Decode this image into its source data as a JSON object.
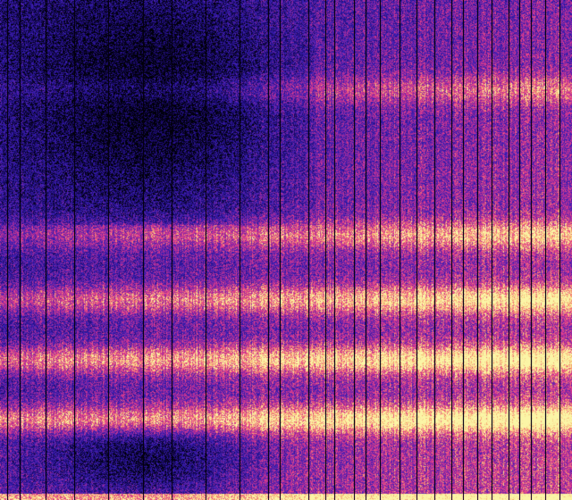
{
  "chart_data": {
    "type": "heatmap",
    "title": "",
    "xlabel": "",
    "ylabel": "",
    "colormap": "plasma-like",
    "colors": {
      "min": "#000008",
      "low": "#1a0a6e",
      "mid_low": "#3a1fb6",
      "mid": "#a02a9c",
      "mid_high": "#e83f8a",
      "high": "#f7aa6e",
      "max": "#fbf5a6"
    },
    "value_range": [
      0,
      1
    ],
    "grid": false,
    "legend": "none",
    "horizontal_bands": [
      {
        "row_fraction": 0.18,
        "intensity_left": 0.15,
        "intensity_right": 0.55
      },
      {
        "row_fraction": 0.47,
        "intensity_left": 0.35,
        "intensity_right": 0.78
      },
      {
        "row_fraction": 0.6,
        "intensity_left": 0.55,
        "intensity_right": 0.92
      },
      {
        "row_fraction": 0.72,
        "intensity_left": 0.72,
        "intensity_right": 0.98
      },
      {
        "row_fraction": 0.84,
        "intensity_left": 0.8,
        "intensity_right": 1.0
      }
    ],
    "dark_regions": [
      {
        "col_fraction_range": [
          0.1,
          0.45
        ],
        "row_fraction_range": [
          0.02,
          0.4
        ],
        "intensity": 0.05
      },
      {
        "col_fraction_range": [
          0.12,
          0.4
        ],
        "row_fraction_range": [
          0.86,
          0.98
        ],
        "intensity": 0.08
      }
    ],
    "vertical_dropout_columns": [
      0.012,
      0.035,
      0.08,
      0.13,
      0.19,
      0.25,
      0.3,
      0.36,
      0.42,
      0.47,
      0.49,
      0.54,
      0.57,
      0.585,
      0.62,
      0.64,
      0.665,
      0.7,
      0.73,
      0.76,
      0.79,
      0.81,
      0.835,
      0.86,
      0.89,
      0.91,
      0.93,
      0.955,
      0.98
    ]
  }
}
